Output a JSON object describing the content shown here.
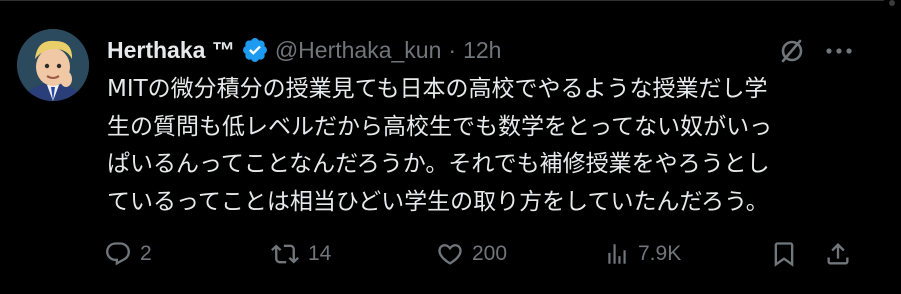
{
  "author": {
    "display_name": "Herthaka ™",
    "handle": "@Herthaka_kun",
    "separator": "·",
    "time": "12h",
    "verified": true
  },
  "tweet": {
    "text": "MITの微分積分の授業見ても日本の高校でやるような授業だし学\n生の質問も低レベルだから高校生でも数学をとってない奴がいっ\nぱいるんってことなんだろうか。それでも補修授業をやろうとし\nているってことは相当ひどい学生の取り方をしていたんだろう。"
  },
  "actions": {
    "reply_count": "2",
    "retweet_count": "14",
    "like_count": "200",
    "views_count": "7.9K"
  },
  "icons": {
    "verified": "verified-badge-icon",
    "grok": "grok-icon",
    "more": "more-icon",
    "reply": "reply-icon",
    "retweet": "retweet-icon",
    "like": "like-icon",
    "views": "views-icon",
    "bookmark": "bookmark-icon",
    "share": "share-icon"
  },
  "colors": {
    "background": "#000000",
    "text": "#e7e9ea",
    "secondary": "#71767b",
    "verified": "#1d9bf0"
  }
}
